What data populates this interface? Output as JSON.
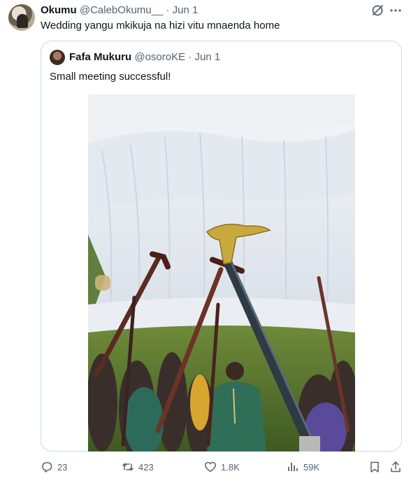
{
  "tweet": {
    "author_name": "Okumu",
    "author_handle": "@CalebOkumu__",
    "separator": "·",
    "date": "Jun 1",
    "text": "Wedding yangu mkikuja na hizi vitu mnaenda home"
  },
  "quoted": {
    "author_name": "Fafa Mukuru",
    "author_handle": "@osoroKE",
    "separator": "·",
    "date": "Jun 1",
    "text": "Small meeting successful!"
  },
  "actions": {
    "replies": "23",
    "reposts": "423",
    "likes": "1.8K",
    "views": "59K"
  },
  "icons": {
    "header": [
      "grok-icon",
      "more-icon"
    ],
    "actions": [
      "reply-icon",
      "repost-icon",
      "like-icon",
      "views-icon",
      "bookmark-icon",
      "share-icon"
    ]
  },
  "colors": {
    "text_primary": "#0f1419",
    "text_secondary": "#536471",
    "border": "#cfd9de"
  }
}
